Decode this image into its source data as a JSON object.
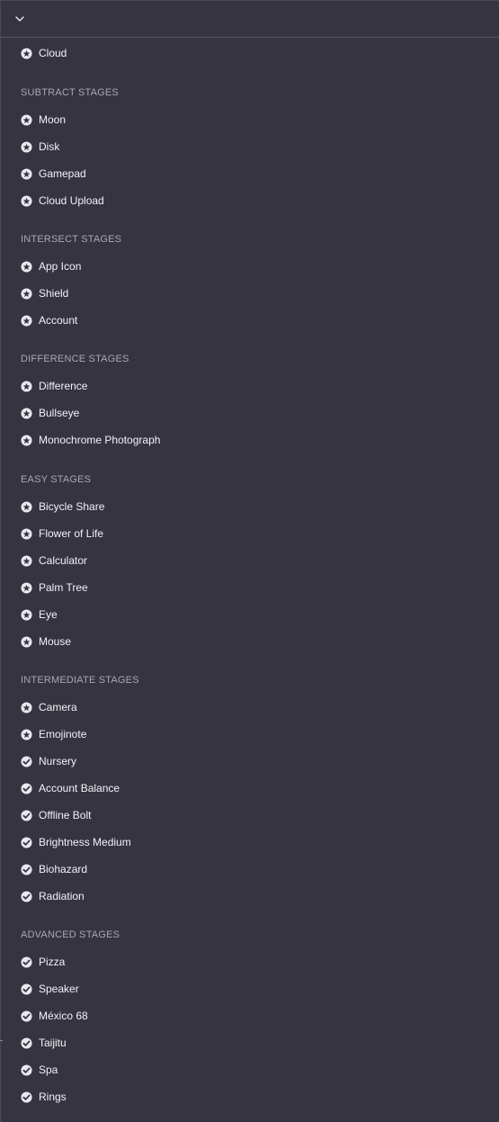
{
  "header": {
    "toggle_icon": "chevron-down-icon"
  },
  "colors": {
    "background": "#363441",
    "text": "#f2f2f5",
    "section": "#a9a7b3",
    "icon": "#e8e8ee"
  },
  "top_items": [
    {
      "label": "Cloud",
      "icon": "star-circle-icon"
    }
  ],
  "sections": [
    {
      "title": "SUBTRACT STAGES",
      "items": [
        {
          "label": "Moon",
          "icon": "star-circle-icon"
        },
        {
          "label": "Disk",
          "icon": "star-circle-icon"
        },
        {
          "label": "Gamepad",
          "icon": "star-circle-icon"
        },
        {
          "label": "Cloud Upload",
          "icon": "star-circle-icon"
        }
      ]
    },
    {
      "title": "INTERSECT STAGES",
      "items": [
        {
          "label": "App Icon",
          "icon": "star-circle-icon"
        },
        {
          "label": "Shield",
          "icon": "star-circle-icon"
        },
        {
          "label": "Account",
          "icon": "star-circle-icon"
        }
      ]
    },
    {
      "title": "DIFFERENCE STAGES",
      "items": [
        {
          "label": "Difference",
          "icon": "star-circle-icon"
        },
        {
          "label": "Bullseye",
          "icon": "star-circle-icon"
        },
        {
          "label": "Monochrome Photograph",
          "icon": "star-circle-icon"
        }
      ]
    },
    {
      "title": "EASY STAGES",
      "items": [
        {
          "label": "Bicycle Share",
          "icon": "star-circle-icon"
        },
        {
          "label": "Flower of Life",
          "icon": "star-circle-icon"
        },
        {
          "label": "Calculator",
          "icon": "star-circle-icon"
        },
        {
          "label": "Palm Tree",
          "icon": "star-circle-icon"
        },
        {
          "label": "Eye",
          "icon": "star-circle-icon"
        },
        {
          "label": "Mouse",
          "icon": "star-circle-icon"
        }
      ]
    },
    {
      "title": "INTERMEDIATE STAGES",
      "items": [
        {
          "label": "Camera",
          "icon": "star-circle-icon"
        },
        {
          "label": "Emojinote",
          "icon": "star-circle-icon"
        },
        {
          "label": "Nursery",
          "icon": "check-circle-icon"
        },
        {
          "label": "Account Balance",
          "icon": "check-circle-icon"
        },
        {
          "label": "Offline Bolt",
          "icon": "check-circle-icon"
        },
        {
          "label": "Brightness Medium",
          "icon": "check-circle-icon"
        },
        {
          "label": "Biohazard",
          "icon": "check-circle-icon"
        },
        {
          "label": "Radiation",
          "icon": "check-circle-icon"
        }
      ]
    },
    {
      "title": "ADVANCED STAGES",
      "items": [
        {
          "label": "Pizza",
          "icon": "check-circle-icon"
        },
        {
          "label": "Speaker",
          "icon": "check-circle-icon"
        },
        {
          "label": "México 68",
          "icon": "check-circle-icon"
        },
        {
          "label": "Taijitu",
          "icon": "check-circle-icon"
        },
        {
          "label": "Spa",
          "icon": "check-circle-icon"
        },
        {
          "label": "Rings",
          "icon": "check-circle-icon"
        }
      ]
    }
  ]
}
